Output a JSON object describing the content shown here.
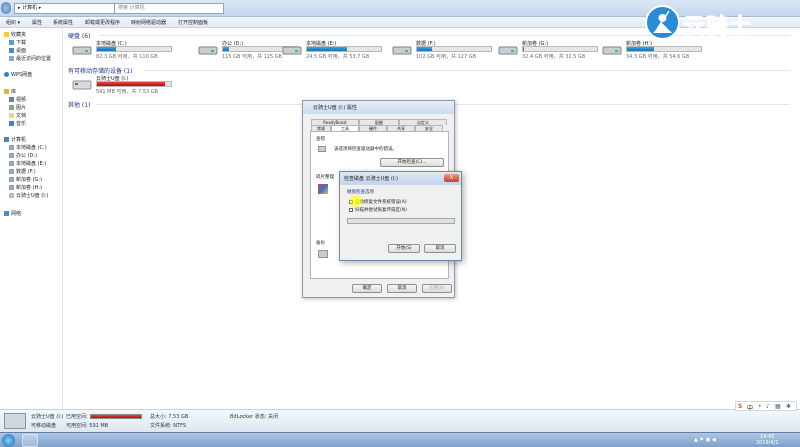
{
  "window": {
    "address_prefix": "▸ 计算机 ▸",
    "search_placeholder": "搜索 计算机"
  },
  "menu": [
    "组织 ▾",
    "属性",
    "系统属性",
    "卸载或更改程序",
    "映射网络驱动器",
    "打开控制面板"
  ],
  "nav": {
    "favorites": [
      "收藏夹",
      "下载",
      "桌面",
      "最近访问的位置"
    ],
    "wps": "WPS网盘",
    "libraries": [
      "库",
      "视频",
      "图片",
      "文档",
      "音乐"
    ],
    "computer": [
      "计算机",
      "本地磁盘 (C:)",
      "办公 (D:)",
      "本地磁盘 (E:)",
      "数据 (F:)",
      "新加卷 (G:)",
      "新加卷 (H:)",
      "云骑士U盘 (I:)"
    ],
    "network": "网络"
  },
  "groups": {
    "hard_disks": "硬盘 (6)",
    "removable": "有可移动存储的设备 (1)",
    "other": "其他 (1)"
  },
  "drives": [
    {
      "name": "本地磁盘 (C:)",
      "info": "82.3 GB 可用，共 110 GB",
      "used_fraction": 0.25,
      "color": "blue"
    },
    {
      "name": "办公 (D:)",
      "info": "115 GB 可用，共 125 GB",
      "used_fraction": 0.08,
      "color": "blue"
    },
    {
      "name": "本地磁盘 (E:)",
      "info": "24.5 GB 可用，共 53.7 GB",
      "used_fraction": 0.54,
      "color": "blue"
    },
    {
      "name": "数据 (F:)",
      "info": "102 GB 可用，共 127 GB",
      "used_fraction": 0.2,
      "color": "blue"
    },
    {
      "name": "新加卷 (G:)",
      "info": "32.4 GB 可用，共 32.5 GB",
      "used_fraction": 0.01,
      "color": "blue"
    },
    {
      "name": "新加卷 (H:)",
      "info": "34.3 GB 可用，共 54.6 GB",
      "used_fraction": 0.37,
      "color": "blue"
    }
  ],
  "usb": {
    "name": "云骑士U盘 (I:)",
    "info": "591 MB 可用，共 7.53 GB",
    "used_fraction": 0.92,
    "color": "red"
  },
  "props_dialog": {
    "title": "云骑士U盘 (I:) 属性",
    "tabs_row1": [
      "ReadyBoost",
      "配额",
      "自定义"
    ],
    "tabs_row2": [
      "常规",
      "工具",
      "硬件",
      "共享",
      "安全"
    ],
    "check_section": "查错",
    "check_desc": "该选项将检查驱动器中的错误。",
    "check_button": "开始检查(C)...",
    "defrag_section": "碎片整理",
    "backup_section": "备份",
    "ok": "确定",
    "cancel": "取消",
    "apply": "应用(A)"
  },
  "check_dialog": {
    "title": "检查磁盘 云骑士U盘 (I:)",
    "options_label": "磁盘检查选项",
    "option1": "自动修复文件系统错误(A)",
    "option2": "扫描并尝试恢复坏扇区(N)",
    "start": "开始(S)",
    "cancel": "取消",
    "close": "X"
  },
  "details": {
    "name": "云骑士U盘 (I:)",
    "used_label": "已用空间:",
    "type": "可移动磁盘",
    "free_label": "可用空间: 591 MB",
    "total": "总大小: 7.53 GB",
    "fs": "文件系统: NTFS",
    "bitlocker": "BitLocker 状态: 关闭"
  },
  "watermark": "云骑士",
  "ime": {
    "s": "S",
    "lang": "中"
  },
  "clock": {
    "time": "14:45",
    "date": "2019/4/1"
  }
}
